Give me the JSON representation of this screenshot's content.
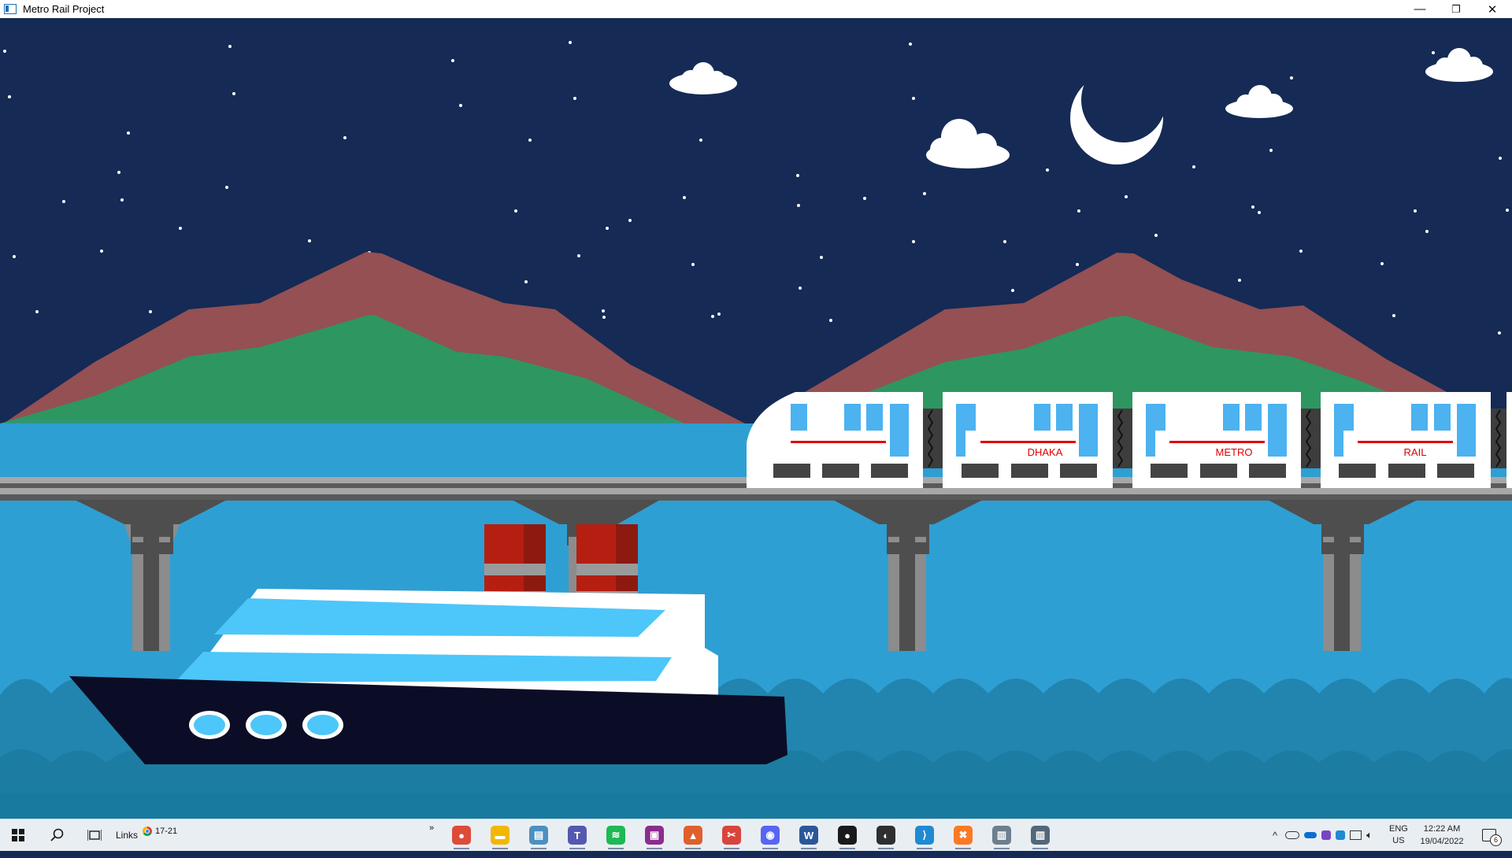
{
  "window": {
    "title": "Metro Rail Project",
    "controls": {
      "minimize": "—",
      "maximize": "❐",
      "close": "✕"
    }
  },
  "scene": {
    "colors": {
      "sky": "#152a55",
      "mountain_back": "#945053",
      "mountain_front": "#2e9660",
      "water": "#2e9fd3",
      "wave_dark": "#2285af",
      "wave_deep": "#18789e",
      "bridge_deck": "#a7a7a7",
      "pillar": "#4e4e4e",
      "train_body": "#ffffff",
      "train_window": "#4cb2f0",
      "train_stripe": "#e00000",
      "ship_hull": "#0b0d26",
      "ship_deck": "#4dc6fa",
      "chimney": "#b51f12"
    },
    "train": {
      "car_labels": [
        "",
        "DHAKA",
        "METRO",
        "RAIL"
      ]
    },
    "icons": [
      "moon-icon",
      "cloud-icon",
      "star-icon"
    ]
  },
  "taskbar": {
    "links_label": "Links",
    "chrome_tab_label": "17-21",
    "overflow": "»",
    "apps": [
      {
        "name": "chrome-icon",
        "color": "#dd4b39",
        "glyph": "●"
      },
      {
        "name": "file-explorer-icon",
        "color": "#f2b705",
        "glyph": "▬"
      },
      {
        "name": "notepad-icon",
        "color": "#4a90c2",
        "glyph": "▤"
      },
      {
        "name": "teams-icon",
        "color": "#5558af",
        "glyph": "T"
      },
      {
        "name": "spotify-icon",
        "color": "#1db954",
        "glyph": "≋"
      },
      {
        "name": "winrar-icon",
        "color": "#8b2c8f",
        "glyph": "▣"
      },
      {
        "name": "matlab-icon",
        "color": "#e0602c",
        "glyph": "▲"
      },
      {
        "name": "snipping-tool-icon",
        "color": "#d8453c",
        "glyph": "✂"
      },
      {
        "name": "discord-icon",
        "color": "#5865f2",
        "glyph": "◉"
      },
      {
        "name": "word-icon",
        "color": "#2b579a",
        "glyph": "W"
      },
      {
        "name": "obs-record-icon",
        "color": "#1a1a1a",
        "glyph": "●"
      },
      {
        "name": "obs-studio-icon",
        "color": "#2f2f2f",
        "glyph": "◐"
      },
      {
        "name": "vscode-icon",
        "color": "#1f8ad2",
        "glyph": "⟩"
      },
      {
        "name": "xampp-icon",
        "color": "#fb7a24",
        "glyph": "✖"
      },
      {
        "name": "app-window-icon",
        "color": "#6e7f8e",
        "glyph": "▥"
      },
      {
        "name": "metro-rail-window-icon",
        "color": "#52677a",
        "glyph": "▥"
      }
    ],
    "tray": {
      "language_top": "ENG",
      "language_bottom": "US",
      "time": "12:22 AM",
      "date": "19/04/2022",
      "notification_count": "6",
      "chevron": "^"
    }
  }
}
